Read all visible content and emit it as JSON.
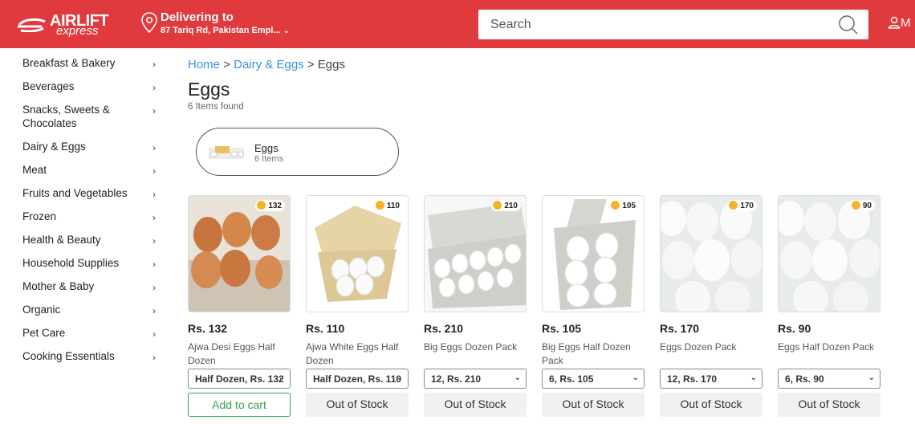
{
  "header": {
    "brand_top": "AIRLIFT",
    "brand_bottom": "express",
    "delivering_title": "Delivering to",
    "delivering_address": "87 Tariq Rd, Pakistan Empl...",
    "search_placeholder": "Search",
    "account_label": "M",
    "brand_color": "#e13a3e"
  },
  "sidebar": {
    "items": [
      {
        "label": "Breakfast & Bakery"
      },
      {
        "label": "Beverages"
      },
      {
        "label": "Snacks, Sweets & Chocolates"
      },
      {
        "label": "Dairy & Eggs"
      },
      {
        "label": "Meat"
      },
      {
        "label": "Fruits and Vegetables"
      },
      {
        "label": "Frozen"
      },
      {
        "label": "Health & Beauty"
      },
      {
        "label": "Household Supplies"
      },
      {
        "label": "Mother & Baby"
      },
      {
        "label": "Organic"
      },
      {
        "label": "Pet Care"
      },
      {
        "label": "Cooking Essentials"
      }
    ]
  },
  "breadcrumb": {
    "home": "Home",
    "sep1": " > ",
    "parent": "Dairy & Eggs",
    "sep2": " > ",
    "current": "Eggs"
  },
  "page": {
    "title": "Eggs",
    "count": "6 Items found"
  },
  "subcategory": {
    "name": "Eggs",
    "items": "6 Items"
  },
  "products": [
    {
      "coins": "132",
      "price": "Rs. 132",
      "name": "Ajwa Desi Eggs Half Dozen",
      "variant": "Half Dozen, Rs. 132",
      "action": "Add to cart",
      "in_stock": true
    },
    {
      "coins": "110",
      "price": "Rs. 110",
      "name": "Ajwa White Eggs Half Dozen",
      "variant": "Half Dozen, Rs. 110",
      "action": "Out of Stock",
      "in_stock": false
    },
    {
      "coins": "210",
      "price": "Rs. 210",
      "name": "Big Eggs Dozen Pack",
      "variant": "12, Rs. 210",
      "action": "Out of Stock",
      "in_stock": false
    },
    {
      "coins": "105",
      "price": "Rs. 105",
      "name": "Big Eggs Half Dozen Pack",
      "variant": "6, Rs. 105",
      "action": "Out of Stock",
      "in_stock": false
    },
    {
      "coins": "170",
      "price": "Rs. 170",
      "name": "Eggs Dozen Pack",
      "variant": "12, Rs. 170",
      "action": "Out of Stock",
      "in_stock": false
    },
    {
      "coins": "90",
      "price": "Rs. 90",
      "name": "Eggs Half Dozen Pack",
      "variant": "6, Rs. 90",
      "action": "Out of Stock",
      "in_stock": false
    }
  ]
}
